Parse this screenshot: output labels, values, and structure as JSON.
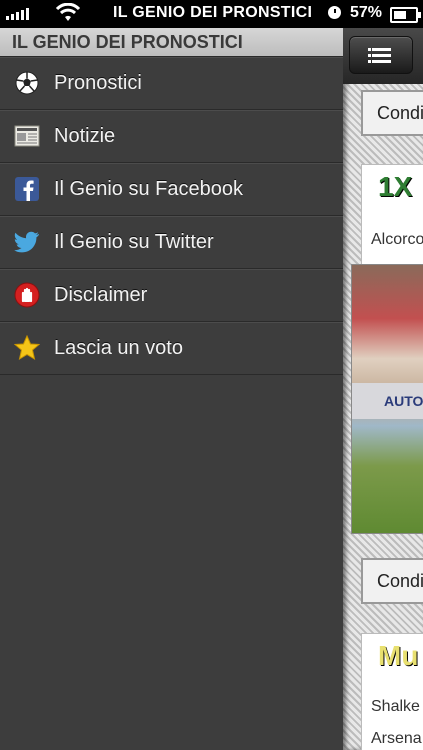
{
  "status_bar": {
    "carrier": "IL GENIO DEI PRONSTICI",
    "battery_percent": "57%"
  },
  "drawer": {
    "title": "IL GENIO DEI PRONOSTICI",
    "items": [
      {
        "label": "Pronostici",
        "icon": "soccer-ball-icon"
      },
      {
        "label": "Notizie",
        "icon": "newspaper-icon"
      },
      {
        "label": "Il Genio su Facebook",
        "icon": "facebook-icon"
      },
      {
        "label": "Il Genio su Twitter",
        "icon": "twitter-bird-icon"
      },
      {
        "label": "Disclaimer",
        "icon": "stop-hand-icon"
      },
      {
        "label": "Lascia un voto",
        "icon": "star-icon"
      }
    ]
  },
  "content": {
    "condition_button_1": "Condi",
    "card_1": {
      "logo_text": "1X",
      "team_text": "Alcorco"
    },
    "photo_banner_text": "AUTO",
    "condition_button_2": "Condi",
    "card_2": {
      "logo_text": "Mu",
      "team_1": "Shalke",
      "team_2": "Arsena"
    }
  },
  "colors": {
    "drawer_bg": "#3d3d3d",
    "header_bg": "#c8c8c8",
    "status_bar_bg": "#000000",
    "facebook_blue": "#3b5998",
    "twitter_blue": "#4aa8e0",
    "disclaimer_red": "#d42020",
    "star_yellow": "#f5c518"
  }
}
